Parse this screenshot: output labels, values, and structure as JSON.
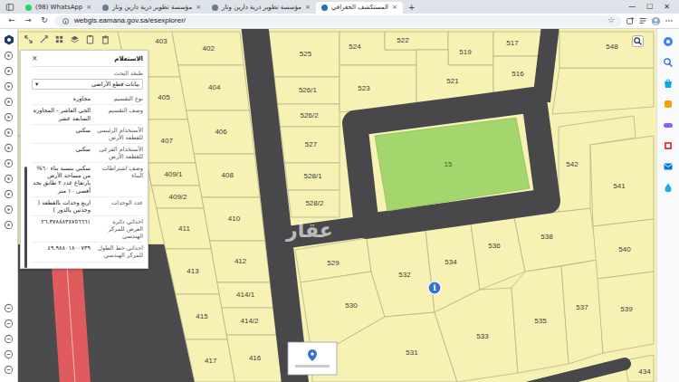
{
  "browser": {
    "tabs": [
      {
        "label": "(98) WhatsApp",
        "selected": false,
        "color": "#25d366"
      },
      {
        "label": "مؤسسة تطوير ذرية دارين وتار",
        "selected": false,
        "color": "#6b7b8c"
      },
      {
        "label": "مؤسسة تطوير ذرية دارين وتار",
        "selected": false,
        "color": "#6b7b8c"
      },
      {
        "label": "المستكشف الجغرافي",
        "selected": true,
        "color": "#2f6db5"
      }
    ],
    "tab_close": "×",
    "new_tab": "+",
    "window_controls": [
      "—",
      "☐",
      "✕"
    ],
    "nav": [
      "←",
      "→",
      "↻"
    ],
    "url": "webgis.eamana.gov.sa/esexplorer/",
    "bookmark": "☆"
  },
  "query_panel": {
    "title": "الاستعلام",
    "close": "×",
    "layer_label": "طبقة البحث",
    "layer_value": "بيانات قطع الأراضي",
    "dropdown_arrow": "▾",
    "rows": [
      {
        "label": "نوع التقسيم",
        "value": "مجاورة"
      },
      {
        "label": "وصف التقسيم",
        "value": "الحي العاشر - المجاورة السابعة عشر"
      },
      {
        "label": "الأستخدام الرئيسي للقطعة الأرض",
        "value": "سكني"
      },
      {
        "label": "الأستخدام الفرعي للقطعة الأرض",
        "value": "سكني"
      },
      {
        "label": "وصف اشتراطات البناء",
        "value": "سكني بنسبة بناء ٦٠% من مساحة الأرض بارتفاع عدد ٢ طابق بحد أقصى ١٠ متر"
      },
      {
        "label": "عدد الوحدات",
        "value": "اربع وحدات بالقطعة ( وحدتين بالدور )"
      },
      {
        "label": "احداثي دائرة العرض للمركز الهندسي",
        "value": "٢٦.٣٧٨٨٨٣٨٧٥٦٦٦١"
      },
      {
        "label": "احداثي خط الطول للمركز الهندسي",
        "value": "٤٩.٩٨٨٠١٨٠٠٧٣٩"
      }
    ]
  },
  "map": {
    "parcels": [
      {
        "label": "403"
      },
      {
        "label": "405"
      },
      {
        "label": "407"
      },
      {
        "label": "409/1"
      },
      {
        "label": "409/2"
      },
      {
        "label": "411"
      },
      {
        "label": "413"
      },
      {
        "label": "415"
      },
      {
        "label": "417"
      },
      {
        "label": "402"
      },
      {
        "label": "404"
      },
      {
        "label": "406"
      },
      {
        "label": "408"
      },
      {
        "label": "410"
      },
      {
        "label": "412"
      },
      {
        "label": "414/1"
      },
      {
        "label": "414/2"
      },
      {
        "label": "416"
      },
      {
        "label": "525"
      },
      {
        "label": "526/1"
      },
      {
        "label": "526/2"
      },
      {
        "label": "527"
      },
      {
        "label": "528/1"
      },
      {
        "label": "528/2"
      },
      {
        "label": "524"
      },
      {
        "label": "522"
      },
      {
        "label": "519"
      },
      {
        "label": "523"
      },
      {
        "label": "521"
      },
      {
        "label": "517"
      },
      {
        "label": "516"
      },
      {
        "label": "548"
      },
      {
        "label": "529"
      },
      {
        "label": "530"
      },
      {
        "label": "532"
      },
      {
        "label": "534"
      },
      {
        "label": "536"
      },
      {
        "label": "538"
      },
      {
        "label": "531"
      },
      {
        "label": "533"
      },
      {
        "label": "535"
      },
      {
        "label": "537"
      },
      {
        "label": "542"
      },
      {
        "label": "541"
      },
      {
        "label": "540"
      },
      {
        "label": "539"
      },
      {
        "label": "434"
      }
    ],
    "park": "15",
    "marker": "i",
    "watermark": "عقار"
  }
}
